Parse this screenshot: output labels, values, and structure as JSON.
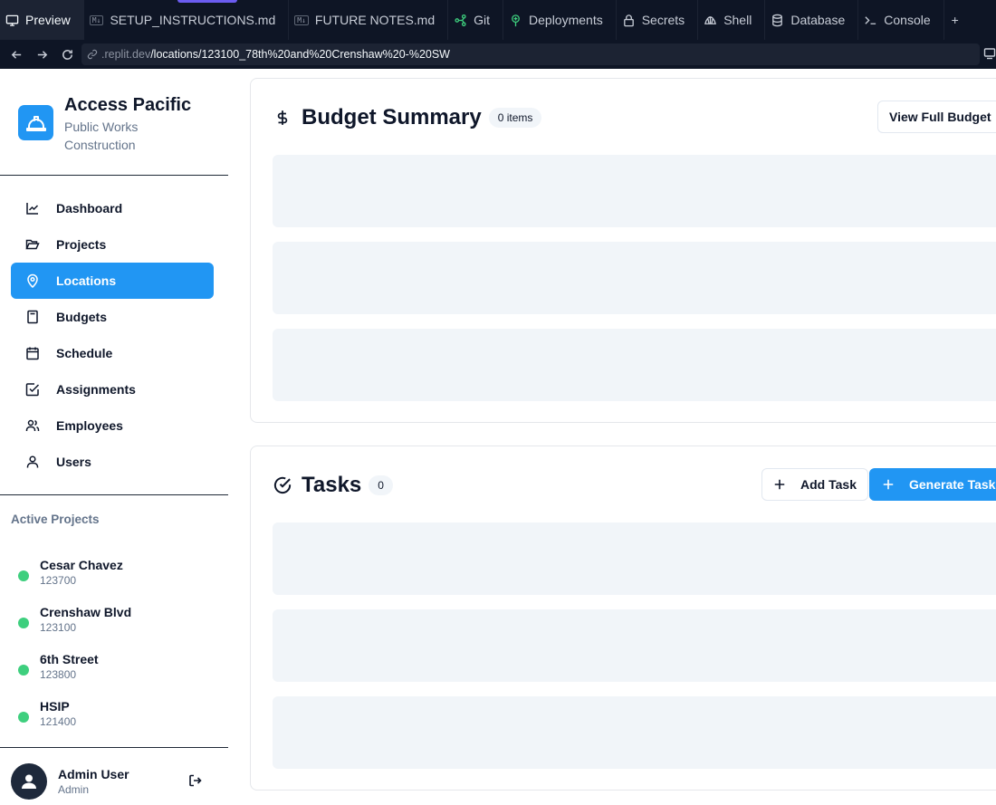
{
  "browser": {
    "tabs": [
      {
        "label": "Preview",
        "icon": "monitor-icon",
        "active": true
      },
      {
        "label": "SETUP_INSTRUCTIONS.md",
        "icon": "markdown-icon"
      },
      {
        "label": "FUTURE NOTES.md",
        "icon": "markdown-icon"
      },
      {
        "label": "Git",
        "icon": "git-icon"
      },
      {
        "label": "Deployments",
        "icon": "deployments-icon"
      },
      {
        "label": "Secrets",
        "icon": "lock-icon"
      },
      {
        "label": "Shell",
        "icon": "shell-icon"
      },
      {
        "label": "Database",
        "icon": "database-icon"
      },
      {
        "label": "Console",
        "icon": "console-icon"
      }
    ],
    "md_badge": "M↓",
    "url_domain": ".replit.dev",
    "url_path": "/locations/123100_78th%20and%20Crenshaw%20-%20SW"
  },
  "sidebar": {
    "brand_title": "Access Pacific",
    "brand_subtitle": "Public Works Construction",
    "nav": [
      {
        "label": "Dashboard",
        "icon": "chart-line-icon"
      },
      {
        "label": "Projects",
        "icon": "folder-open-icon"
      },
      {
        "label": "Locations",
        "icon": "map-pin-icon",
        "active": true
      },
      {
        "label": "Budgets",
        "icon": "calculator-icon"
      },
      {
        "label": "Schedule",
        "icon": "calendar-icon"
      },
      {
        "label": "Assignments",
        "icon": "check-square-icon"
      },
      {
        "label": "Employees",
        "icon": "users-icon"
      },
      {
        "label": "Users",
        "icon": "user-icon"
      }
    ],
    "active_projects_title": "Active Projects",
    "projects": [
      {
        "name": "Cesar Chavez",
        "code": "123700"
      },
      {
        "name": "Crenshaw Blvd",
        "code": "123100"
      },
      {
        "name": "6th Street",
        "code": "123800"
      },
      {
        "name": "HSIP",
        "code": "121400"
      }
    ],
    "user_name": "Admin User",
    "user_role": "Admin"
  },
  "budget": {
    "title": "Budget Summary",
    "count": "0 items",
    "view_button": "View Full Budget"
  },
  "tasks": {
    "title": "Tasks",
    "count": "0",
    "add_button": "Add Task",
    "generate_button": "Generate Tasks"
  },
  "colors": {
    "accent": "#2196f3",
    "status_active": "#3ecf7e",
    "skeleton": "#f1f5f9",
    "chrome_bg": "#0e1525"
  }
}
